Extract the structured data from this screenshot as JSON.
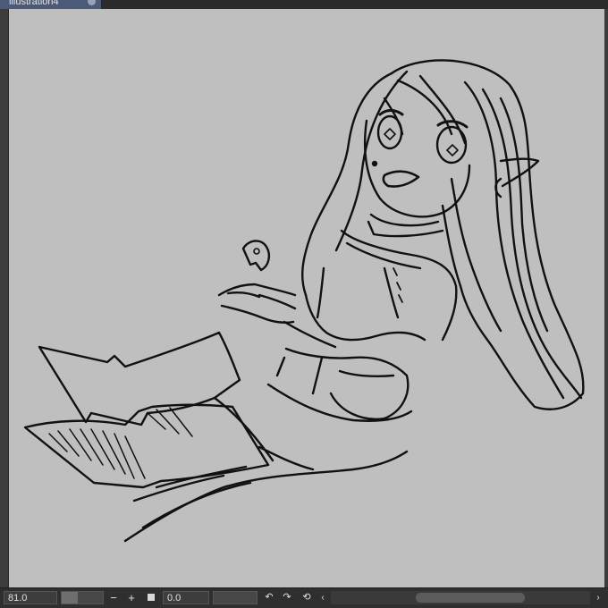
{
  "tab": {
    "title": "illustration4"
  },
  "status_bar": {
    "zoom_value": "81.0",
    "zoom_out_label": "−",
    "zoom_in_label": "+",
    "rotation_value": "0.0",
    "rotate_left_glyph": "↶",
    "rotate_right_glyph": "↷",
    "reset_glyph": "⟲",
    "scroll_left_glyph": "‹",
    "scroll_right_glyph": "›"
  },
  "canvas": {
    "background": "#bfbfbf",
    "line_color": "#111111",
    "subject": "sketch-chibi-elf-girl"
  },
  "colors": {
    "tab_active": "#4a5a78",
    "ui_dark": "#2f2f2f"
  },
  "icons": {
    "close": "close-icon",
    "zoom_out": "minus-icon",
    "zoom_in": "plus-icon",
    "fit": "fit-screen-icon",
    "rotate_left": "rotate-left-icon",
    "rotate_right": "rotate-right-icon",
    "reset_rotation": "reset-rotation-icon"
  }
}
